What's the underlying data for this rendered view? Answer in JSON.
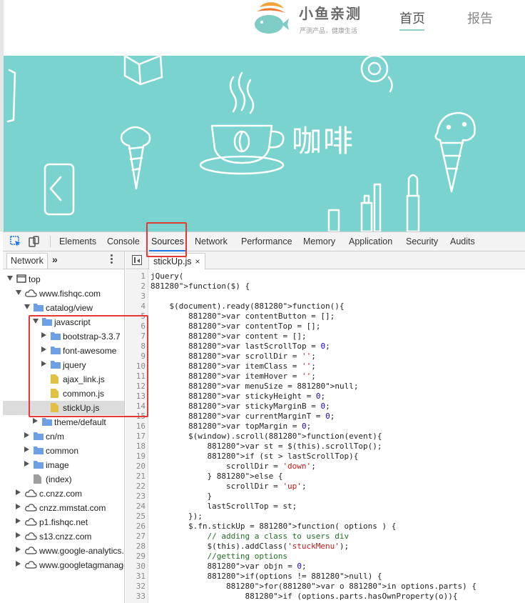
{
  "site": {
    "brand_name": "小鱼亲测",
    "slogan": "严测产品，健康生活",
    "nav": [
      {
        "label": "首页",
        "active": true
      },
      {
        "label": "报告",
        "active": false
      }
    ],
    "banner_text": "咖啡",
    "banner_color": "#7bd3cf"
  },
  "devtools": {
    "toolbar_icons": [
      "inspect-element-icon",
      "device-toggle-icon"
    ],
    "tabs": [
      "Elements",
      "Console",
      "Sources",
      "Network",
      "Performance",
      "Memory",
      "Application",
      "Security",
      "Audits"
    ],
    "active_tab": "Sources",
    "navigator": {
      "tab_label": "Network",
      "more_label": "»",
      "tree": [
        {
          "label": "top",
          "depth": 0,
          "kind": "frame",
          "arrow": "down"
        },
        {
          "label": "www.fishqc.com",
          "depth": 1,
          "kind": "cloud",
          "arrow": "down"
        },
        {
          "label": "catalog/view",
          "depth": 2,
          "kind": "folder",
          "arrow": "down"
        },
        {
          "label": "javascript",
          "depth": 3,
          "kind": "folder",
          "arrow": "down"
        },
        {
          "label": "bootstrap-3.3.7",
          "depth": 4,
          "kind": "folder",
          "arrow": "right"
        },
        {
          "label": "font-awesome",
          "depth": 4,
          "kind": "folder",
          "arrow": "right"
        },
        {
          "label": "jquery",
          "depth": 4,
          "kind": "folder",
          "arrow": "right"
        },
        {
          "label": "ajax_link.js",
          "depth": 4,
          "kind": "file",
          "arrow": "none"
        },
        {
          "label": "common.js",
          "depth": 4,
          "kind": "file",
          "arrow": "none"
        },
        {
          "label": "stickUp.js",
          "depth": 4,
          "kind": "file",
          "arrow": "none",
          "selected": true
        },
        {
          "label": "theme/default",
          "depth": 3,
          "kind": "folder",
          "arrow": "right"
        },
        {
          "label": "cn/m",
          "depth": 2,
          "kind": "folder",
          "arrow": "right"
        },
        {
          "label": "common",
          "depth": 2,
          "kind": "folder",
          "arrow": "right"
        },
        {
          "label": "image",
          "depth": 2,
          "kind": "folder",
          "arrow": "right"
        },
        {
          "label": "(index)",
          "depth": 2,
          "kind": "file-gray",
          "arrow": "none"
        },
        {
          "label": "c.cnzz.com",
          "depth": 1,
          "kind": "cloud",
          "arrow": "right"
        },
        {
          "label": "cnzz.mmstat.com",
          "depth": 1,
          "kind": "cloud",
          "arrow": "right"
        },
        {
          "label": "p1.fishqc.net",
          "depth": 1,
          "kind": "cloud",
          "arrow": "right"
        },
        {
          "label": "s13.cnzz.com",
          "depth": 1,
          "kind": "cloud",
          "arrow": "right"
        },
        {
          "label": "www.google-analytics.c",
          "depth": 1,
          "kind": "cloud",
          "arrow": "right"
        },
        {
          "label": "www.googletagmanage",
          "depth": 1,
          "kind": "cloud",
          "arrow": "right"
        }
      ]
    },
    "editor": {
      "file_tab": "stickUp.js",
      "close_label": "×",
      "lines": [
        {
          "n": "1",
          "code": "jQuery("
        },
        {
          "n": "2",
          "code": "function($) {"
        },
        {
          "n": "3",
          "code": ""
        },
        {
          "n": "4",
          "code": "    $(document).ready(function(){"
        },
        {
          "n": "5",
          "code": "        var contentButton = [];"
        },
        {
          "n": "6",
          "code": "        var contentTop = [];"
        },
        {
          "n": "7",
          "code": "        var content = [];"
        },
        {
          "n": "8",
          "code": "        var lastScrollTop = 0;"
        },
        {
          "n": "9",
          "code": "        var scrollDir = '';"
        },
        {
          "n": "10",
          "code": "        var itemClass = '';"
        },
        {
          "n": "11",
          "code": "        var itemHover = '';"
        },
        {
          "n": "12",
          "code": "        var menuSize = null;"
        },
        {
          "n": "13",
          "code": "        var stickyHeight = 0;"
        },
        {
          "n": "14",
          "code": "        var stickyMarginB = 0;"
        },
        {
          "n": "15",
          "code": "        var currentMarginT = 0;"
        },
        {
          "n": "16",
          "code": "        var topMargin = 0;"
        },
        {
          "n": "17",
          "code": "        $(window).scroll(function(event){"
        },
        {
          "n": "18",
          "code": "            var st = $(this).scrollTop();"
        },
        {
          "n": "19",
          "code": "            if (st > lastScrollTop){"
        },
        {
          "n": "20",
          "code": "                scrollDir = 'down';"
        },
        {
          "n": "21",
          "code": "            } else {"
        },
        {
          "n": "22",
          "code": "                scrollDir = 'up';"
        },
        {
          "n": "23",
          "code": "            }"
        },
        {
          "n": "24",
          "code": "            lastScrollTop = st;"
        },
        {
          "n": "25",
          "code": "        });"
        },
        {
          "n": "26",
          "code": "        $.fn.stickUp = function( options ) {"
        },
        {
          "n": "27",
          "code": "            // adding a class to users div"
        },
        {
          "n": "28",
          "code": "            $(this).addClass('stuckMenu');"
        },
        {
          "n": "29",
          "code": "            //getting options"
        },
        {
          "n": "30",
          "code": "            var objn = 0;"
        },
        {
          "n": "31",
          "code": "            if(options != null) {"
        },
        {
          "n": "32",
          "code": "                for(var o in options.parts) {"
        },
        {
          "n": "33",
          "code": "                    if (options.parts.hasOwnProperty(o)){"
        }
      ]
    }
  }
}
